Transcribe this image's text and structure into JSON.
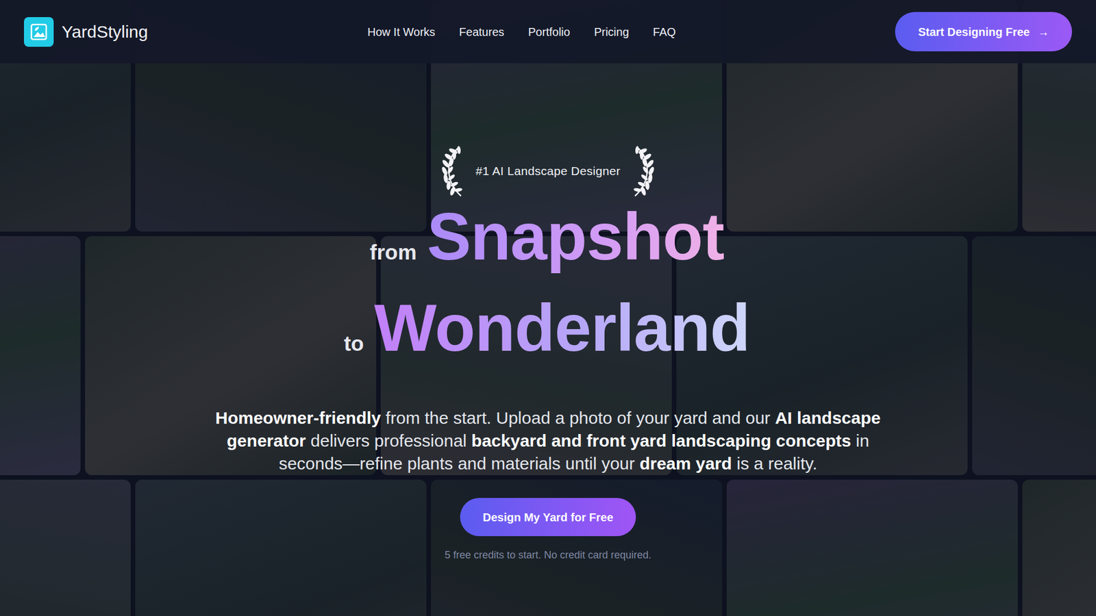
{
  "nav": {
    "brand": "YardStyling",
    "links": [
      "How It Works",
      "Features",
      "Portfolio",
      "Pricing",
      "FAQ"
    ],
    "cta": {
      "label": "Start Designing Free",
      "arrow": "→"
    }
  },
  "hero": {
    "badge": "#1 AI Landscape Designer",
    "headline": [
      {
        "prefix": "from",
        "word": "Snapshot"
      },
      {
        "prefix": "to",
        "word": "Wonderland"
      }
    ],
    "description": [
      {
        "text": "Homeowner-friendly",
        "bold": true
      },
      {
        "text": " from the start. Upload a photo of your yard and our ",
        "bold": false
      },
      {
        "text": "AI landscape generator",
        "bold": true
      },
      {
        "text": " delivers professional ",
        "bold": false
      },
      {
        "text": "backyard and front yard landscaping concepts",
        "bold": true
      },
      {
        "text": " in seconds—refine plants and materials until your ",
        "bold": false
      },
      {
        "text": "dream yard",
        "bold": true
      },
      {
        "text": " is a reality.",
        "bold": false
      }
    ],
    "button": "Design My Yard for Free",
    "note": "5 free credits to start. No credit card required."
  }
}
